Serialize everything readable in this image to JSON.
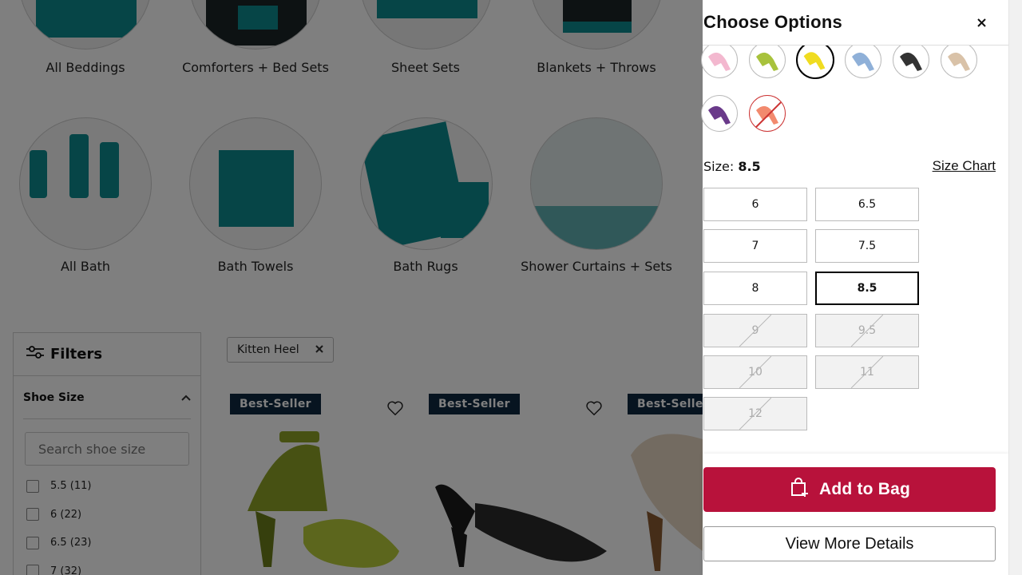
{
  "categories_row1": [
    {
      "label": "All Beddings"
    },
    {
      "label": "Comforters + Bed Sets"
    },
    {
      "label": "Sheet Sets"
    },
    {
      "label": "Blankets + Throws"
    }
  ],
  "categories_row2": [
    {
      "label": "All Bath"
    },
    {
      "label": "Bath Towels"
    },
    {
      "label": "Bath Rugs"
    },
    {
      "label": "Shower Curtains + Sets"
    }
  ],
  "filters": {
    "title": "Filters",
    "section": "Shoe Size",
    "search_placeholder": "Search shoe size",
    "options": [
      "5.5 (11)",
      "6 (22)",
      "6.5 (23)",
      "7 (32)"
    ]
  },
  "active_filter_chip": "Kitten Heel",
  "products": [
    {
      "badge": "Best-Seller"
    },
    {
      "badge": "Best-Seller"
    },
    {
      "badge": "Best-Seller"
    }
  ],
  "modal": {
    "title": "Choose Options",
    "close_label": "×",
    "size_prefix": "Size:",
    "selected_size": "8.5",
    "size_chart_label": "Size Chart",
    "swatch_colors": [
      {
        "name": "pink",
        "color": "#f3b8cf",
        "state": "normal"
      },
      {
        "name": "lime",
        "color": "#a8c23c",
        "state": "normal"
      },
      {
        "name": "yellow",
        "color": "#f0dc20",
        "state": "selected"
      },
      {
        "name": "light-blue",
        "color": "#8fb0d8",
        "state": "normal"
      },
      {
        "name": "black",
        "color": "#333333",
        "state": "normal"
      },
      {
        "name": "beige",
        "color": "#d9c2a8",
        "state": "normal"
      },
      {
        "name": "purple",
        "color": "#6a3a8a",
        "state": "normal"
      },
      {
        "name": "coral",
        "color": "#f28a6e",
        "state": "unavailable"
      }
    ],
    "sizes": [
      {
        "label": "6",
        "state": "available"
      },
      {
        "label": "6.5",
        "state": "available"
      },
      {
        "label": "7",
        "state": "available"
      },
      {
        "label": "7.5",
        "state": "available"
      },
      {
        "label": "8",
        "state": "available"
      },
      {
        "label": "8.5",
        "state": "selected"
      },
      {
        "label": "9",
        "state": "disabled"
      },
      {
        "label": "9.5",
        "state": "disabled"
      },
      {
        "label": "10",
        "state": "disabled"
      },
      {
        "label": "11",
        "state": "disabled"
      },
      {
        "label": "12",
        "state": "disabled"
      }
    ],
    "add_to_bag_label": "Add to Bag",
    "view_more_label": "View More Details"
  },
  "colors": {
    "accent": "#b8123b",
    "badge_bg": "#0f2840",
    "teal": "#0c8a8e"
  }
}
